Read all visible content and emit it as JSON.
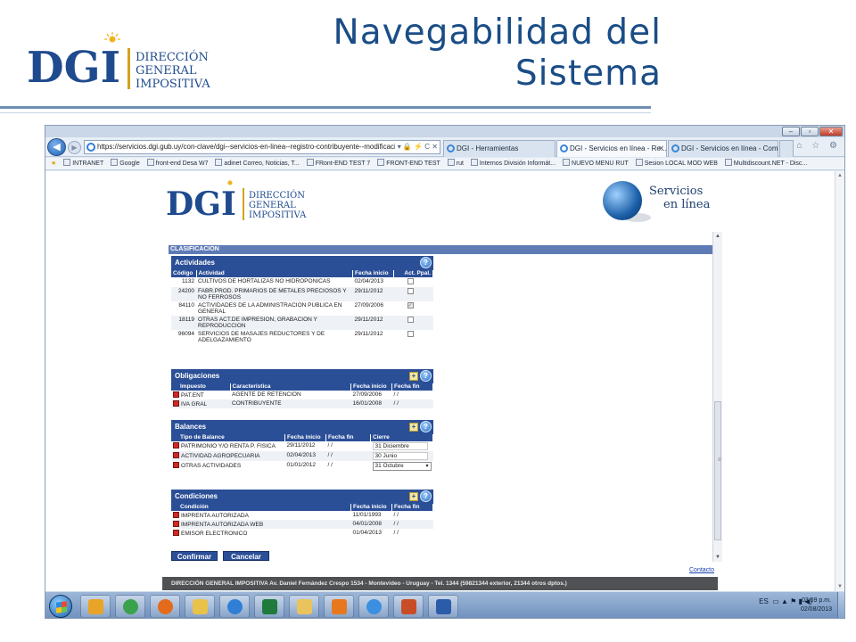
{
  "slide": {
    "title_line1": "Navegabilidad del",
    "title_line2": "Sistema",
    "logo": {
      "mark": "DGI",
      "line1": "DIRECCIÓN",
      "line2": "GENERAL",
      "line3": "IMPOSITIVA"
    }
  },
  "browser": {
    "url": "https://servicios.dgi.gub.uy/con-clave/dgi--servicios-en-linea--registro-contribuyente--modificacion",
    "address_icons": "▾ 🔒 ⚡ C ✕",
    "tabs": [
      {
        "label": "DGI - Herramientas",
        "active": false
      },
      {
        "label": "DGI - Servicios en línea - Re...",
        "active": true
      },
      {
        "label": "DGI - Servicios en línea - Com...",
        "active": false
      }
    ],
    "nav_right": "⌂ ☆ ⚙",
    "favorites": [
      "INTRANET",
      "Google",
      "front-end Desa W7",
      "adinet Correo, Noticias, T...",
      "FRont-END TEST 7",
      "FRONT-END TEST",
      "rut",
      "Internos División Informát...",
      "NUEVO MENU RUT",
      "Sesion LOCAL MOD WEB",
      "Multidiscount.NET - Disc..."
    ]
  },
  "page": {
    "logo": {
      "mark": "DGI",
      "line1": "DIRECCIÓN",
      "line2": "GENERAL",
      "line3": "IMPOSITIVA"
    },
    "services": {
      "line1": "Servicios",
      "line2": "en línea"
    },
    "clasificacion": "CLASIFICACIÓN",
    "actividades": {
      "title": "Actividades",
      "headers": [
        "Código",
        "Actividad",
        "Fecha inicio",
        "Act. Ppal."
      ],
      "rows": [
        {
          "code": "1132",
          "name": "CULTIVOS DE HORTALIZAS NO HIDROPONICAS",
          "date": "02/04/2013",
          "principal": false
        },
        {
          "code": "24200",
          "name": "FABR.PROD. PRIMARIOS DE METALES PRECIOSOS Y NO FERROSOS",
          "date": "29/11/2012",
          "principal": false
        },
        {
          "code": "84110",
          "name": "ACTIVIDADES DE LA ADMINISTRACION PUBLICA EN GENERAL",
          "date": "27/09/2006",
          "principal": true
        },
        {
          "code": "18119",
          "name": "OTRAS ACT.DE IMPRESION, GRABACION Y REPRODUCCION",
          "date": "29/11/2012",
          "principal": false
        },
        {
          "code": "96094",
          "name": "SERVICIOS DE MASAJES REDUCTORES Y DE ADELGAZAMIENTO",
          "date": "29/11/2012",
          "principal": false
        }
      ]
    },
    "obligaciones": {
      "title": "Obligaciones",
      "headers": [
        "Impuesto",
        "Característica",
        "Fecha inicio",
        "Fecha fin"
      ],
      "rows": [
        {
          "impuesto": "PAT.ENT",
          "caracteristica": "AGENTE DE RETENCION",
          "inicio": "27/09/2006",
          "fin": "/ /"
        },
        {
          "impuesto": "IVA GRAL",
          "caracteristica": "CONTRIBUYENTE",
          "inicio": "16/01/2008",
          "fin": "/ /"
        }
      ]
    },
    "balances": {
      "title": "Balances",
      "headers": [
        "Tipo de Balance",
        "Fecha inicio",
        "Fecha fin",
        "Cierre"
      ],
      "rows": [
        {
          "tipo": "PATRIMONIO Y/O RENTA P. FISICA",
          "inicio": "29/11/2012",
          "fin": "/ /",
          "cierre": "31 Diciembre"
        },
        {
          "tipo": "ACTIVIDAD AGROPECUARIA",
          "inicio": "02/04/2013",
          "fin": "/ /",
          "cierre": "30 Junio"
        },
        {
          "tipo": "OTRAS ACTIVIDADES",
          "inicio": "01/01/2012",
          "fin": "/ /",
          "cierre": "31 Octubre"
        }
      ]
    },
    "condiciones": {
      "title": "Condiciones",
      "headers": [
        "Condición",
        "Fecha inicio",
        "Fecha fin"
      ],
      "rows": [
        {
          "condicion": "IMPRENTA AUTORIZADA",
          "inicio": "11/01/1993",
          "fin": "/ /"
        },
        {
          "condicion": "IMPRENTA AUTORIZADA WEB",
          "inicio": "04/01/2008",
          "fin": "/ /"
        },
        {
          "condicion": "EMISOR ELECTRONICO",
          "inicio": "01/04/2013",
          "fin": "/ /"
        }
      ]
    },
    "buttons": {
      "confirm": "Confirmar",
      "cancel": "Cancelar"
    },
    "contacto": "Contacto",
    "footer": "DIRECCIÓN GENERAL IMPOSITIVA Av. Daniel Fernández Crespo 1534 - Montevideo - Uruguay - Tel. 1344 (59821344 exterior, 21344 otros dptos.)"
  },
  "taskbar": {
    "apps": [
      "media-player",
      "chrome",
      "firefox",
      "paint",
      "ie",
      "excel",
      "explorer",
      "fireworks",
      "ie-alt",
      "powerpoint",
      "word"
    ],
    "app_colors": [
      "#e8a426",
      "#3aa24b",
      "#e46b1c",
      "#e8c24a",
      "#2f7fd6",
      "#1f7a3b",
      "#e9c45d",
      "#e8781e",
      "#3b8fe0",
      "#c94d24",
      "#2b5caa"
    ],
    "lang": "ES",
    "tray_icons": "▭ ▲ ⚑ ▮ ◀)",
    "time": "03:59 p.m.",
    "date": "02/08/2013"
  }
}
